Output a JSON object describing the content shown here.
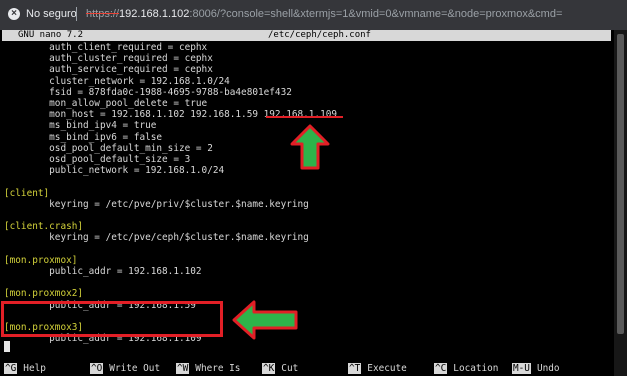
{
  "browser": {
    "security_label": "No seguro",
    "url_scheme": "https://",
    "url_host": "192.168.1.102",
    "url_rest": ":8006/?console=shell&xtermjs=1&vmid=0&vmname=&node=proxmox&cmd="
  },
  "nano": {
    "version": "GNU nano 7.2",
    "filename": "/etc/ceph/ceph.conf"
  },
  "file_lines": [
    "        auth_client_required = cephx",
    "        auth_cluster_required = cephx",
    "        auth_service_required = cephx",
    "        cluster_network = 192.168.1.0/24",
    "        fsid = 878fda0c-1988-4695-9788-ba4e801ef432",
    "        mon_allow_pool_delete = true",
    "        mon_host = 192.168.1.102 192.168.1.59 192.168.1.109",
    "        ms_bind_ipv4 = true",
    "        ms_bind_ipv6 = false",
    "        osd_pool_default_min_size = 2",
    "        osd_pool_default_size = 3",
    "        public_network = 192.168.1.0/24",
    "",
    "[client]",
    "        keyring = /etc/pve/priv/$cluster.$name.keyring",
    "",
    "[client.crash]",
    "        keyring = /etc/pve/ceph/$cluster.$name.keyring",
    "",
    "[mon.proxmox]",
    "        public_addr = 192.168.1.102",
    "",
    "[mon.proxmox2]",
    "        public_addr = 192.168.1.59",
    "",
    "[mon.proxmox3]",
    "        public_addr = 192.168.1.109"
  ],
  "shortcuts": [
    {
      "key": "^G",
      "label": "Help"
    },
    {
      "key": "^O",
      "label": "Write Out"
    },
    {
      "key": "^W",
      "label": "Where Is"
    },
    {
      "key": "^K",
      "label": "Cut"
    },
    {
      "key": "^T",
      "label": "Execute"
    },
    {
      "key": "^C",
      "label": "Location"
    },
    {
      "key": "M-U",
      "label": "Undo"
    }
  ],
  "colors": {
    "annotation_red": "#e21f26",
    "arrow_green": "#2eb34a",
    "section_yellow": "#d3d23a"
  }
}
